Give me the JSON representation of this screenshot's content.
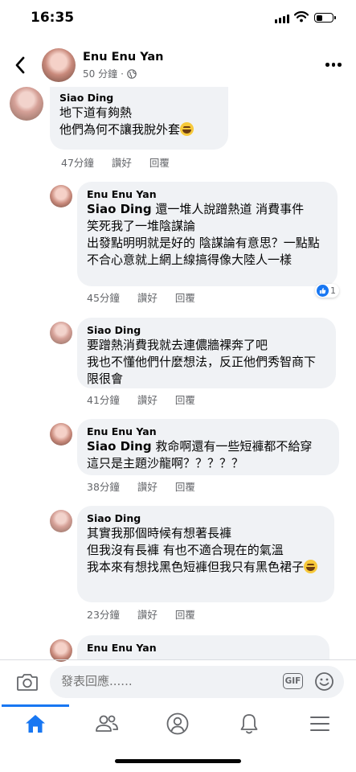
{
  "status_bar": {
    "time": "16:35"
  },
  "header": {
    "name": "Enu Enu Yan",
    "time": "50 分鐘"
  },
  "comments": [
    {
      "author": "Siao Ding",
      "tag": "",
      "text": "地下道有夠熱\n他們為何不讓我脫外套",
      "emoji": "laughing-emoji",
      "time": "47分鐘",
      "like": "讚好",
      "reply": "回覆"
    },
    {
      "author": "Enu Enu Yan",
      "tag": "Siao Ding",
      "text": " 還一堆人說蹭熱道 消費事件\n笑死我了一堆陰謀論\n出發點明明就是好的 陰謀論有意思？一點點不合心意就上網上線搞得像大陸人一樣",
      "time": "45分鐘",
      "like": "讚好",
      "reply": "回覆",
      "reaction_count": "1"
    },
    {
      "author": "Siao Ding",
      "tag": "",
      "text": "要蹭熱消費我就去連儂牆裸奔了吧\n我也不懂他們什麼想法，反正他們秀智商下限很會",
      "time": "41分鐘",
      "like": "讚好",
      "reply": "回覆"
    },
    {
      "author": "Enu Enu Yan",
      "tag": "Siao Ding",
      "text": " 救命啊還有一些短褲都不給穿\n這只是主題沙龍啊？？？？？",
      "time": "38分鐘",
      "like": "讚好",
      "reply": "回覆"
    },
    {
      "author": "Siao Ding",
      "tag": "",
      "text": "其實我那個時候有想著長褲\n但我沒有長褲  有也不適合現在的氣溫\n我本來有想找黑色短褲但我只有黑色裙子",
      "emoji": "laughing-emoji",
      "time": "23分鐘",
      "like": "讚好",
      "reply": "回覆"
    },
    {
      "author": "Enu Enu Yan"
    }
  ],
  "composer": {
    "placeholder": "發表回應......",
    "gif_label": "GIF"
  },
  "colors": {
    "accent": "#1877f2",
    "bubble": "#f0f2f5",
    "meta": "#65676b"
  }
}
